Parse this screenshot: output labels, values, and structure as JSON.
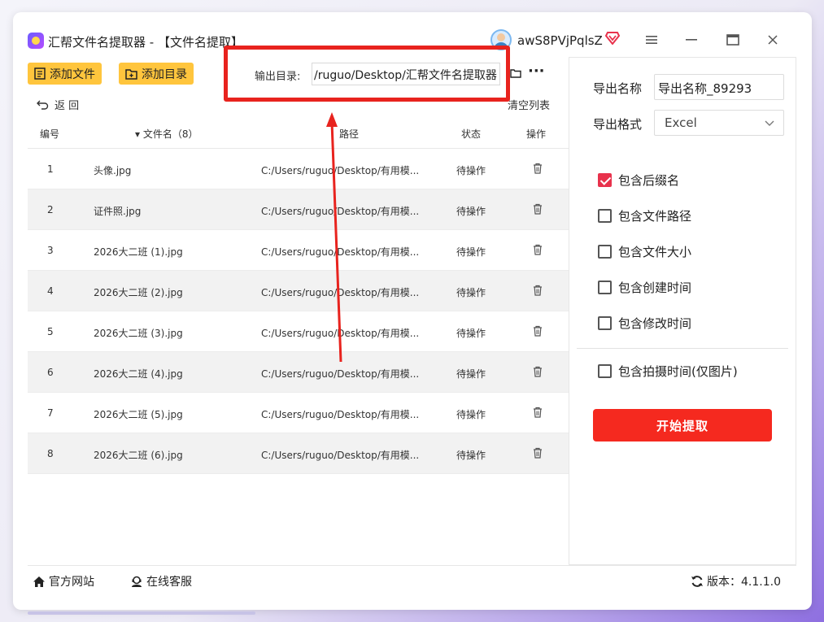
{
  "app": {
    "title": "汇帮文件名提取器 - 【文件名提取】",
    "username": "awS8PVjPqlsZ"
  },
  "toolbar": {
    "add_file": "添加文件",
    "add_dir": "添加目录",
    "output_label": "输出目录:",
    "output_path": "/ruguo/Desktop/汇帮文件名提取器",
    "more": "···",
    "back": "返  回",
    "clear_list": "清空列表"
  },
  "table": {
    "headers": {
      "index": "编号",
      "filename": "▾ 文件名（8）",
      "path": "路径",
      "status": "状态",
      "action": "操作"
    },
    "rows": [
      {
        "index": "1",
        "name": "头像.jpg",
        "path": "C:/Users/ruguo/Desktop/有用模...",
        "status": "待操作"
      },
      {
        "index": "2",
        "name": "证件照.jpg",
        "path": "C:/Users/ruguo/Desktop/有用模...",
        "status": "待操作"
      },
      {
        "index": "3",
        "name": "2026大二班 (1).jpg",
        "path": "C:/Users/ruguo/Desktop/有用模...",
        "status": "待操作"
      },
      {
        "index": "4",
        "name": "2026大二班 (2).jpg",
        "path": "C:/Users/ruguo/Desktop/有用模...",
        "status": "待操作"
      },
      {
        "index": "5",
        "name": "2026大二班 (3).jpg",
        "path": "C:/Users/ruguo/Desktop/有用模...",
        "status": "待操作"
      },
      {
        "index": "6",
        "name": "2026大二班 (4).jpg",
        "path": "C:/Users/ruguo/Desktop/有用模...",
        "status": "待操作"
      },
      {
        "index": "7",
        "name": "2026大二班 (5).jpg",
        "path": "C:/Users/ruguo/Desktop/有用模...",
        "status": "待操作"
      },
      {
        "index": "8",
        "name": "2026大二班 (6).jpg",
        "path": "C:/Users/ruguo/Desktop/有用模...",
        "status": "待操作"
      }
    ]
  },
  "panel": {
    "export_name_label": "导出名称",
    "export_name_value": "导出名称_89293",
    "export_format_label": "导出格式",
    "export_format_value": "Excel",
    "options": [
      {
        "label": "包含后缀名",
        "checked": true
      },
      {
        "label": "包含文件路径",
        "checked": false
      },
      {
        "label": "包含文件大小",
        "checked": false
      },
      {
        "label": "包含创建时间",
        "checked": false
      },
      {
        "label": "包含修改时间",
        "checked": false
      }
    ],
    "photo_option": {
      "label": "包含拍摄时间(仅图片)",
      "checked": false
    },
    "start_button": "开始提取"
  },
  "footer": {
    "website": "官方网站",
    "support": "在线客服",
    "version": "版本：4.1.1.0"
  },
  "colors": {
    "accent_yellow": "#ffc53d",
    "start_red": "#f5291f",
    "checkbox_red": "#e8324c",
    "annotation_red": "#e8231e"
  }
}
